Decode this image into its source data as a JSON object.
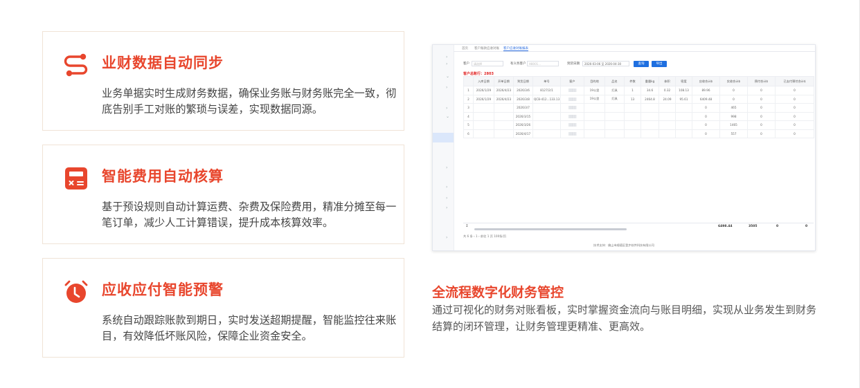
{
  "features": [
    {
      "title": "业财数据自动同步",
      "desc": "业务单据实时生成财务数据，确保业务账与财务账完全一致，彻底告别手工对账的繁琐与误差，实现数据同源。",
      "icon": "sync-route-icon"
    },
    {
      "title": "智能费用自动核算",
      "desc": "基于预设规则自动计算运费、杂费及保险费用，精准分摊至每一笔订单，减少人工计算错误，提升成本核算效率。",
      "icon": "calculator-icon"
    },
    {
      "title": "应收应付智能预警",
      "desc": "系统自动跟踪账款到期日，实时发送超期提醒，智能监控往来账目，有效降低坏账风险，保障企业资金安全。",
      "icon": "alarm-clock-icon"
    }
  ],
  "screenshot": {
    "tabs": [
      "首页",
      "客户账款应收对账",
      "客户应收对账报表"
    ],
    "filters": {
      "customer_label": "客户",
      "customer_placeholder": "请选择",
      "owner_label": "有义务客户",
      "owner_value": "H8001...",
      "date_label": "到货日期",
      "date_value": "2026-03-06 至 2026-04-30",
      "query_button": "查询",
      "export_button": "导出"
    },
    "count_text": "客户总账行：2803",
    "columns": [
      "",
      "入库日期",
      "开单日期",
      "到货日期",
      "单号",
      "客户",
      "目的地",
      "品名",
      "件数",
      "重量kg",
      "体积",
      "密度",
      "应收合计$",
      "实收合计$",
      "预付合计$",
      "已支付预付合计$"
    ],
    "rows": [
      [
        "1",
        "2026/1/29",
        "2026/4/23",
        "2026/3/6",
        "8127/2/1",
        "▒▒▒▒",
        "19公里",
        "灯具",
        "1",
        "34.6",
        "0.32",
        "108.13",
        "89.96",
        "0",
        "0",
        "0"
      ],
      [
        "2",
        "2026/1/29",
        "2026/4/23",
        "2026/3/8",
        "QCB-412...133.13",
        "▒▒▒▒",
        "19公里",
        "灯具",
        "13",
        "2464.8",
        "24.09",
        "95.61",
        "6409.48",
        "0",
        "0",
        "0"
      ],
      [
        "3",
        "",
        "",
        "2026/3/7",
        "",
        "▒▒▒▒",
        "",
        "",
        "",
        "",
        "",
        "",
        "0",
        "465",
        "0",
        "0"
      ],
      [
        "4",
        "",
        "",
        "2026/3/15",
        "",
        "▒▒▒▒",
        "",
        "",
        "",
        "",
        "",
        "",
        "0",
        "998",
        "0",
        "0"
      ],
      [
        "5",
        "",
        "",
        "2026/3/26",
        "",
        "▒▒▒▒",
        "",
        "",
        "",
        "",
        "",
        "",
        "0",
        "1465",
        "0",
        "0"
      ],
      [
        "6",
        "",
        "",
        "2026/4/17",
        "",
        "▒▒▒▒",
        "",
        "",
        "",
        "",
        "",
        "",
        "0",
        "557",
        "0",
        "0"
      ]
    ],
    "sum_symbol": "Σ",
    "sums": [
      "6498.44",
      "3505",
      "0",
      "0"
    ],
    "pager": "共 6 条    ‹  1  ›   前往   1   页    100条/页",
    "footer": "技术支持：佛山市顺德区登步软件科技有限公司"
  },
  "right": {
    "title": "全流程数字化财务管控",
    "desc": "通过可视化的财务对账看板，实时掌握资金流向与账目明细，实现从业务发生到财务结算的闭环管理，让财务管理更精准、更高效。"
  },
  "colors": {
    "accent": "#e8462d",
    "primary_blue": "#1e6fe0"
  }
}
